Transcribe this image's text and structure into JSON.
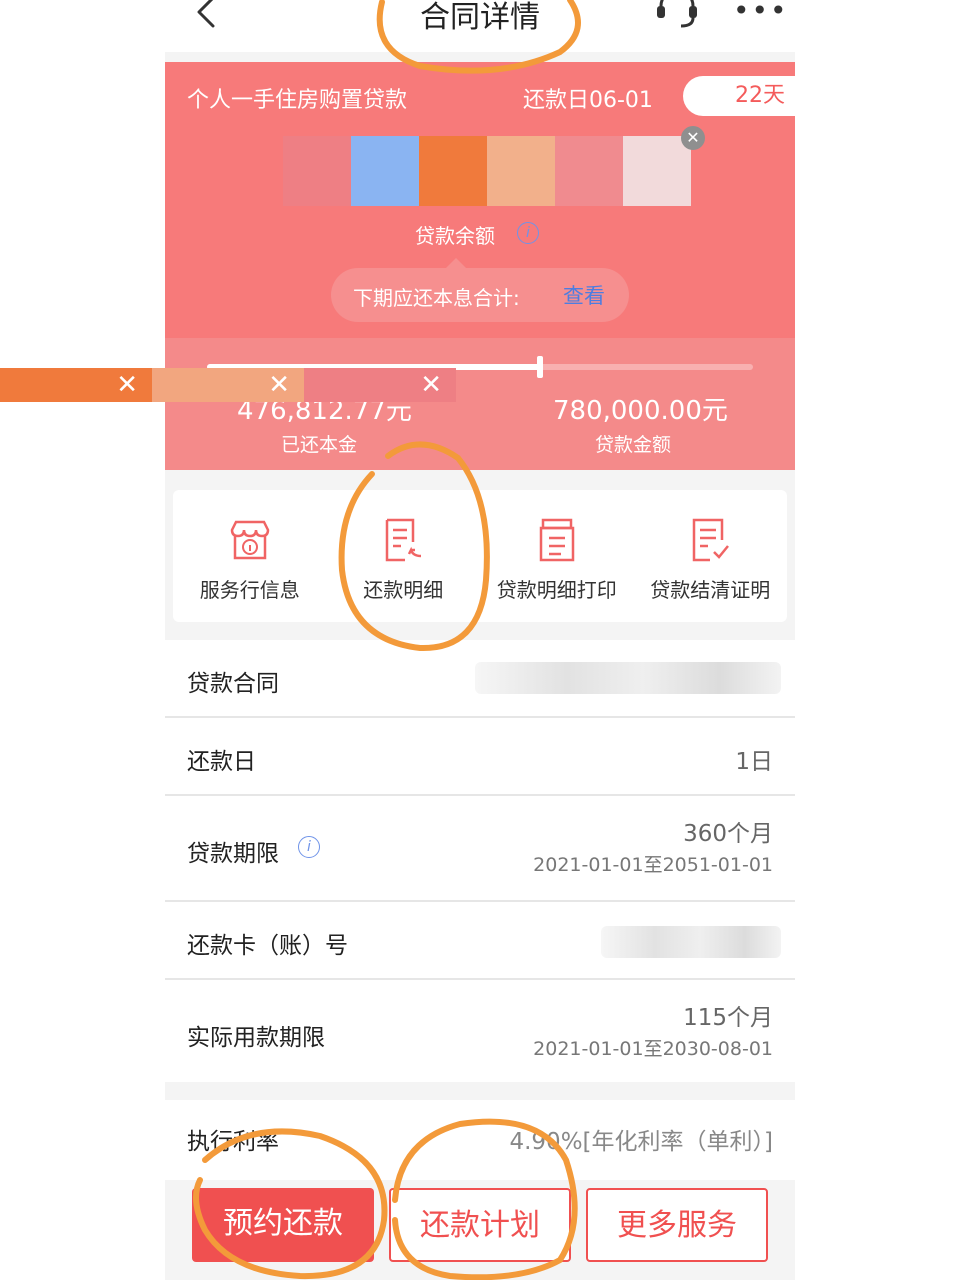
{
  "header": {
    "title": "合同详情",
    "more": "•••"
  },
  "card": {
    "loan_type": "个人一手住房购置贷款",
    "due_label": "还款日06-01",
    "days_left": "22天",
    "balance_label": "贷款余额",
    "next_payment_label": "下期应还本息合计:",
    "next_payment_link": "查看",
    "repaid_amount": "476,812.77元",
    "repaid_label": "已还本金",
    "loan_amount": "780,000.00元",
    "loan_amount_label": "贷款金额",
    "progress_fraction": 0.61
  },
  "actions": [
    {
      "label": "服务行信息",
      "icon": "store-info-icon"
    },
    {
      "label": "还款明细",
      "icon": "repayment-detail-icon"
    },
    {
      "label": "贷款明细打印",
      "icon": "print-statement-icon"
    },
    {
      "label": "贷款结清证明",
      "icon": "settlement-certificate-icon"
    }
  ],
  "rows": {
    "contract": {
      "label": "贷款合同"
    },
    "repay_day": {
      "label": "还款日",
      "value": "1日"
    },
    "term": {
      "label": "贷款期限",
      "value": "360个月",
      "sub": "2021-01-01至2051-01-01"
    },
    "card_no": {
      "label": "还款卡（账）号"
    },
    "actual_term": {
      "label": "实际用款期限",
      "value": "115个月",
      "sub": "2021-01-01至2030-08-01"
    },
    "rate": {
      "label": "执行利率",
      "value": "4.90%[年化利率（单利）]"
    }
  },
  "buttons": {
    "reserve": "预约还款",
    "plan": "还款计划",
    "more": "更多服务"
  },
  "colors": {
    "card_red": "#f77a7a",
    "primary_red": "#f05050",
    "link_blue": "#4d7de0",
    "scribble_orange": "#f39a3a",
    "mosaic": [
      "#ee7f84",
      "#8ab4f2",
      "#f07a3c",
      "#f2b08b",
      "#f08b8f",
      "#f2dadb"
    ],
    "strip": [
      "#f07a3c",
      "#f2a67f",
      "#ee7f84"
    ]
  }
}
